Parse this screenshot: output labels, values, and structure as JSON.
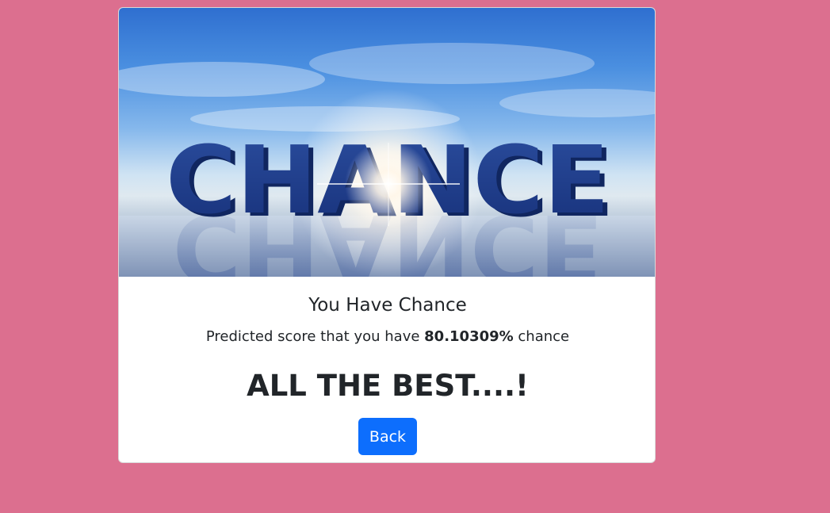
{
  "card": {
    "image": {
      "word": "CHANCE",
      "description_icon": "chance-hero-image"
    },
    "title": "You Have Chance",
    "subtitle_prefix": "Predicted score that you have ",
    "score": "80.10309%",
    "subtitle_suffix": " chance",
    "headline": "ALL THE BEST....!",
    "back_label": "Back"
  },
  "colors": {
    "page_background": "#dc6f8f",
    "button": "#0d6efd",
    "card": "#ffffff",
    "letters": "#1f3f8f"
  }
}
